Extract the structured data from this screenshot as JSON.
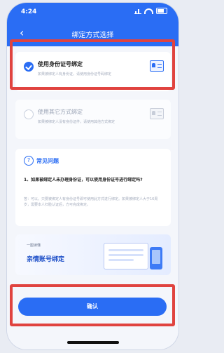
{
  "status_bar": {
    "time": "4:24"
  },
  "nav": {
    "back_glyph": "‹",
    "title": "绑定方式选择"
  },
  "options": [
    {
      "title": "使用身份证号绑定",
      "desc": "如果被绑定人有身份证，请使用身份证号码绑定",
      "selected": true,
      "icon": "id-card-icon"
    },
    {
      "title": "使用其它方式绑定",
      "desc": "如果被绑定人没有身份证件，请使用其他方式绑定",
      "selected": false,
      "icon": "document-icon"
    }
  ],
  "faq": {
    "icon_glyph": "?",
    "title": "常见问题",
    "question": "1、如果被绑定人未办理身份证，可以使用身份证号进行绑定吗?",
    "answer": "答：可以。只要被绑定人有身份证号即可使用此方式进行绑定。如果被绑定人大于16周岁，需要本人扫脸认证后，方可完成绑定。"
  },
  "banner": {
    "subtitle": "一图读懂",
    "title": "亲情账号绑定"
  },
  "confirm": {
    "label": "确认"
  },
  "colors": {
    "primary": "#2a6df4",
    "highlight": "#e0433f"
  }
}
